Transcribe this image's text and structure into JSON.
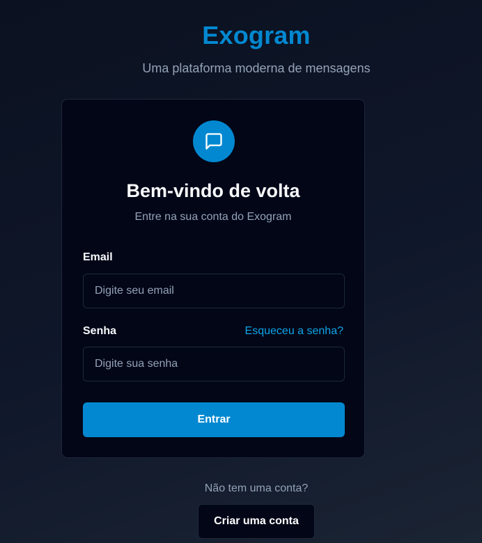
{
  "header": {
    "brand": "Exogram",
    "tagline": "Uma plataforma moderna de mensagens"
  },
  "card": {
    "logo_icon": "message-square-icon",
    "title": "Bem-vindo de volta",
    "subtitle": "Entre na sua conta do Exogram",
    "email": {
      "label": "Email",
      "placeholder": "Digite seu email",
      "value": ""
    },
    "password": {
      "label": "Senha",
      "placeholder": "Digite sua senha",
      "value": ""
    },
    "forgot_link": "Esqueceu a senha?",
    "submit_label": "Entrar"
  },
  "footer": {
    "no_account_text": "Não tem uma conta?",
    "create_account_label": "Criar uma conta"
  },
  "colors": {
    "accent": "#0288d1",
    "link": "#0ea5e9",
    "card_bg": "#020617",
    "page_bg": "#0f172a"
  }
}
